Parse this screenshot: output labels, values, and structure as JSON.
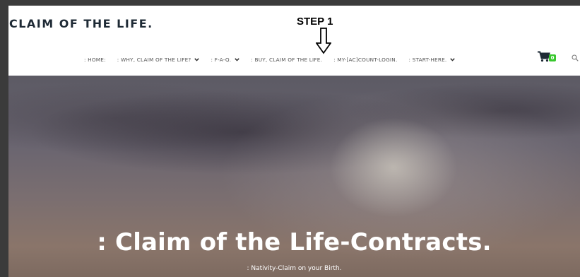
{
  "site": {
    "logo": ": CLAIM OF THE LIFE."
  },
  "annotation": {
    "step": "STEP 1"
  },
  "nav": {
    "items": [
      {
        "label": ": HOME:",
        "dropdown": false
      },
      {
        "label": ": WHY, CLAIM OF THE LIFE?",
        "dropdown": true
      },
      {
        "label": ": F-A-Q.",
        "dropdown": true
      },
      {
        "label": ": BUY, CLAIM OF THE LIFE.",
        "dropdown": false
      },
      {
        "label": ": MY-[AC]COUNT-LOGIN.",
        "dropdown": false
      },
      {
        "label": ": START-HERE.",
        "dropdown": true
      }
    ],
    "cart_count": "0"
  },
  "hero": {
    "title": ": Claim of the Life-Contracts.",
    "subtitle": ": Nativity-Claim on your Birth."
  },
  "colors": {
    "badge": "#38c72e",
    "logo": "#1e2a35"
  },
  "icons": {
    "cart": "cart-icon",
    "search": "search-icon",
    "arrow": "arrow-down-icon",
    "chevron": "chevron-down-icon"
  }
}
